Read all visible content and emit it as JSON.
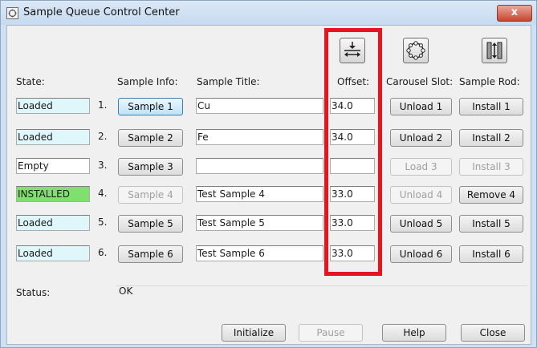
{
  "window": {
    "title": "Sample Queue Control Center",
    "close_glyph": "x"
  },
  "headers": {
    "state": "State:",
    "sample_info": "Sample Info:",
    "sample_title": "Sample Title:",
    "offset": "Offset:",
    "carousel_slot": "Carousel Slot:",
    "sample_rod": "Sample Rod:"
  },
  "icons": {
    "offset": "offset-align-icon",
    "carousel": "carousel-icon",
    "rod": "sample-rod-icon"
  },
  "rows": [
    {
      "state": "Loaded",
      "state_type": "loaded",
      "num": "1.",
      "sample": "Sample 1",
      "title": "Cu",
      "offset": "34.0",
      "slot": "Unload 1",
      "rod": "Install 1"
    },
    {
      "state": "Loaded",
      "state_type": "loaded",
      "num": "2.",
      "sample": "Sample 2",
      "title": "Fe",
      "offset": "34.0",
      "slot": "Unload 2",
      "rod": "Install 2"
    },
    {
      "state": "Empty",
      "state_type": "empty",
      "num": "3.",
      "sample": "Sample 3",
      "title": "",
      "offset": "",
      "slot": "Load 3",
      "rod": "Install 3"
    },
    {
      "state": "INSTALLED",
      "state_type": "installed",
      "num": "4.",
      "sample": "Sample 4",
      "title": "Test Sample 4",
      "offset": "33.0",
      "slot": "Unload 4",
      "rod": "Remove 4"
    },
    {
      "state": "Loaded",
      "state_type": "loaded",
      "num": "5.",
      "sample": "Sample 5",
      "title": "Test Sample 5",
      "offset": "33.0",
      "slot": "Unload 5",
      "rod": "Install 5"
    },
    {
      "state": "Loaded",
      "state_type": "loaded",
      "num": "6.",
      "sample": "Sample 6",
      "title": "Test Sample 6",
      "offset": "33.0",
      "slot": "Unload 6",
      "rod": "Install 6"
    }
  ],
  "status": {
    "label": "Status:",
    "value": "OK"
  },
  "footer": {
    "initialize": "Initialize",
    "pause": "Pause",
    "help": "Help",
    "close": "Close"
  },
  "colors": {
    "loaded": "#dff7fb",
    "installed": "#7fe06e",
    "highlight": "#e5141e"
  }
}
